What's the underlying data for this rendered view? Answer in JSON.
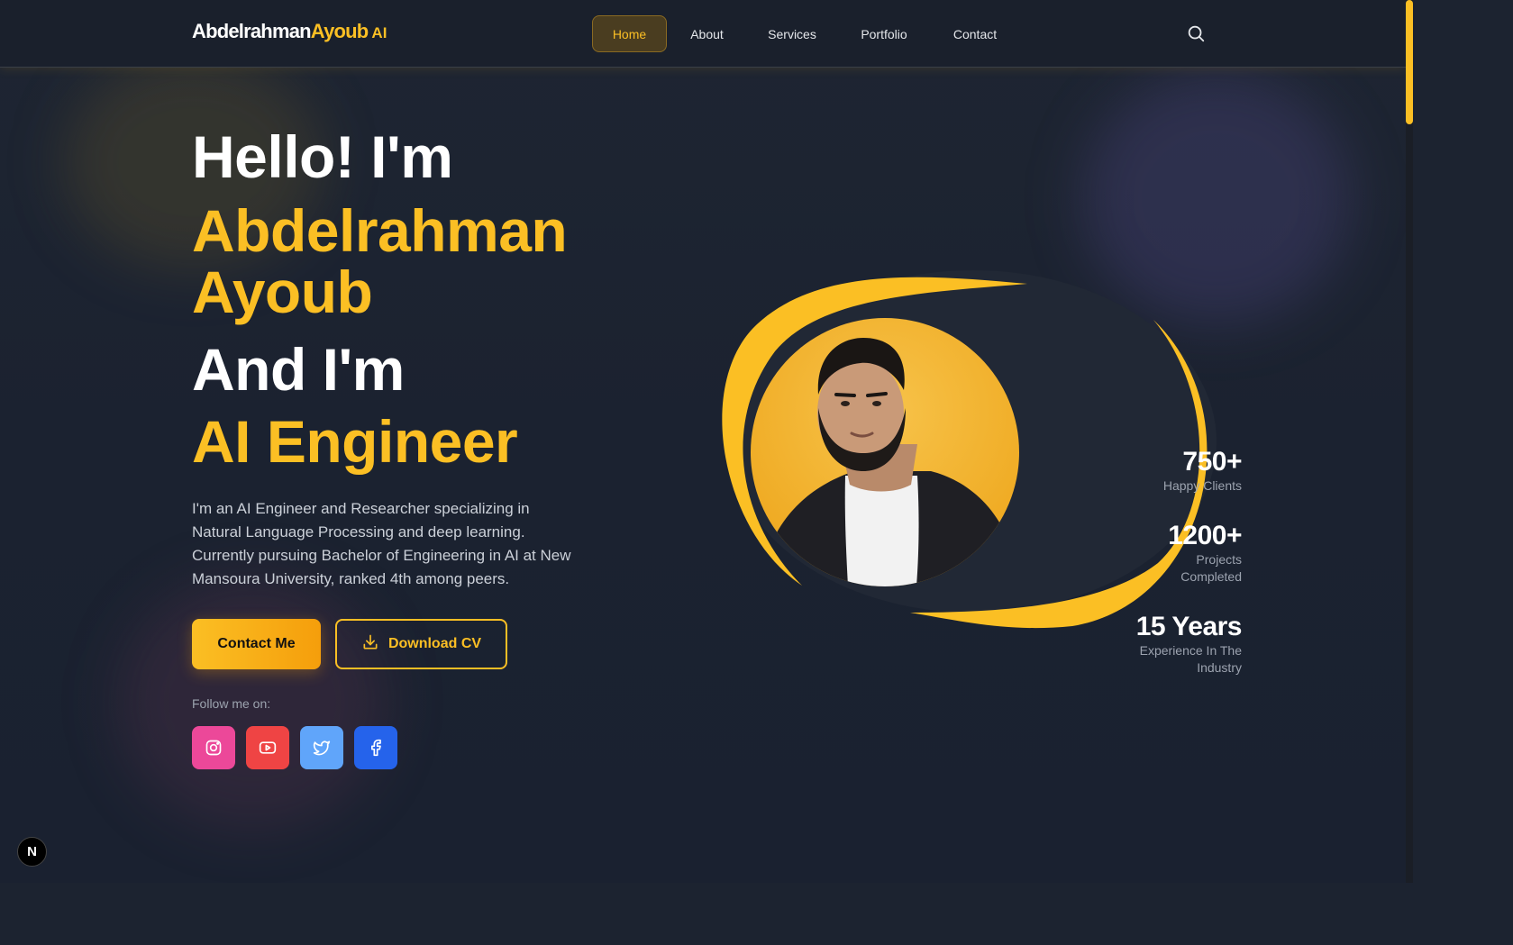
{
  "header": {
    "logo_part1": "Abdelrahman",
    "logo_part2": "Ayoub",
    "logo_part3": "AI",
    "nav": [
      {
        "label": "Home",
        "active": true
      },
      {
        "label": "About",
        "active": false
      },
      {
        "label": "Services",
        "active": false
      },
      {
        "label": "Portfolio",
        "active": false
      },
      {
        "label": "Contact",
        "active": false
      }
    ],
    "search_icon": "search-icon"
  },
  "hero": {
    "greeting": "Hello! I'm",
    "name_line1": "Abdelrahman",
    "name_line2": "Ayoub",
    "and_line": "And I'm",
    "role": "AI Engineer",
    "description": "I'm an AI Engineer and Researcher specializing in Natural Language Processing and deep learning. Currently pursuing Bachelor of Engineering in AI at New Mansoura University, ranked 4th among peers.",
    "contact_button": "Contact Me",
    "cv_button": "Download CV",
    "follow_label": "Follow me on:",
    "socials": [
      {
        "name": "instagram",
        "icon": "instagram-icon",
        "color": "#ec4899"
      },
      {
        "name": "youtube",
        "icon": "youtube-icon",
        "color": "#ef4444"
      },
      {
        "name": "twitter",
        "icon": "twitter-icon",
        "color": "#60a5fa"
      },
      {
        "name": "facebook",
        "icon": "facebook-icon",
        "color": "#2563eb"
      }
    ]
  },
  "stats": [
    {
      "value": "750+",
      "label_line1": "Happy Clients",
      "label_line2": ""
    },
    {
      "value": "1200+",
      "label_line1": "Projects",
      "label_line2": "Completed"
    },
    {
      "value": "15 Years",
      "label_line1": "Experience In The",
      "label_line2": "Industry"
    }
  ],
  "colors": {
    "accent": "#fbbf24",
    "background": "#1c2330",
    "text_muted": "#9ca3af"
  },
  "badge": "N"
}
